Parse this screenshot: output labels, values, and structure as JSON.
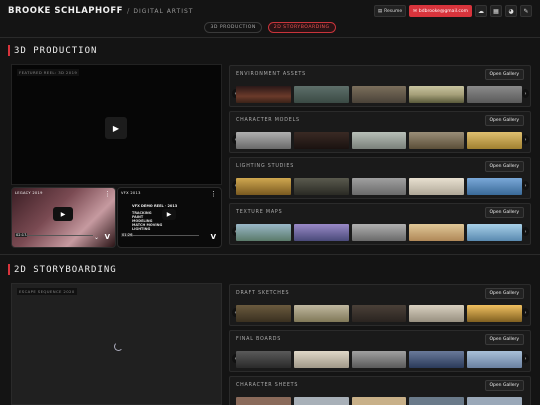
{
  "header": {
    "brand": "BROOKE SCHLAPHOFF",
    "separator": "/",
    "tagline": "DIGITAL ARTIST",
    "resume_label": "Resume",
    "email_label": "bdbrooke@gmail.com"
  },
  "tabs": [
    {
      "label": "3D PRODUCTION",
      "active": false
    },
    {
      "label": "2D STORYBOARDING",
      "active": true
    }
  ],
  "sections": {
    "production": {
      "title": "3D PRODUCTION",
      "featured_label": "FEATURED REEL: 3D 2019",
      "thumb_cards": [
        {
          "title": "LEGACY 2019",
          "duration": "02:17"
        },
        {
          "title": "VFX 2013",
          "subtitle": "VFX DEMO REEL · 2013",
          "overlay_lines": [
            "TRACKING",
            "PAINT",
            "MODELING",
            "MATCH MOVING",
            "LIGHTING"
          ],
          "duration": "01:26"
        }
      ],
      "galleries": [
        {
          "title": "ENVIRONMENT ASSETS",
          "button": "Open Gallery",
          "swatches": [
            "#6b3a2a",
            "#5e6f6a",
            "#7b6f5c",
            "#a6a07a",
            "#5a5a5a"
          ]
        },
        {
          "title": "CHARACTER MODELS",
          "button": "Open Gallery",
          "swatches": [
            "#8a8a8a",
            "#3a2a24",
            "#9aa09a",
            "#7b6e58",
            "#c0a050"
          ]
        },
        {
          "title": "LIGHTING STUDIES",
          "button": "Open Gallery",
          "swatches": [
            "#b08a3a",
            "#4a4a3e",
            "#8a8a8a",
            "#d0c8b8",
            "#4a7aa8"
          ]
        },
        {
          "title": "TEXTURE MAPS",
          "button": "Open Gallery",
          "swatches": [
            "#6a8a9a",
            "#6a6a9a",
            "#8a8a8a",
            "#c8a878",
            "#6a9ab0"
          ]
        }
      ]
    },
    "storyboarding": {
      "title": "2D STORYBOARDING",
      "featured_label": "ESCAPE SEQUENCE 2020",
      "galleries": [
        {
          "title": "DRAFT SKETCHES",
          "button": "Open Gallery",
          "swatches": [
            "#6a5a3e",
            "#a0987a",
            "#4a4038",
            "#b8b0a0",
            "#d8a850"
          ]
        },
        {
          "title": "FINAL BOARDS",
          "button": "Open Gallery",
          "swatches": [
            "#4a4a4a",
            "#c8c0b0",
            "#8a8a8a",
            "#4a5a7a",
            "#8aa0b8"
          ]
        },
        {
          "title": "CHARACTER SHEETS",
          "button": "Open Gallery",
          "swatches": [
            "#8a6a5a",
            "#a8b0b8",
            "#c8b088",
            "#6a7a8a",
            "#9aa8b8"
          ]
        }
      ]
    }
  },
  "colors": {
    "accent": "#d8343c",
    "background": "#141414",
    "panel": "#1a1a1a"
  },
  "icons": [
    "file-icon",
    "mail-icon",
    "cloud-icon",
    "film-icon",
    "palette-icon",
    "pen-icon",
    "play-icon",
    "vimeo-icon",
    "chevron-left-icon",
    "chevron-right-icon",
    "more-icon"
  ]
}
